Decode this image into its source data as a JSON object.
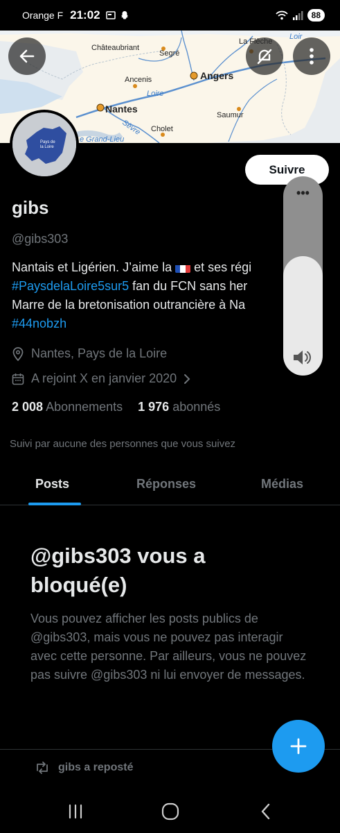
{
  "status_bar": {
    "carrier": "Orange F",
    "time": "21:02",
    "battery": "88"
  },
  "banner": {
    "map_labels": {
      "chateaubriant": "Châteaubriant",
      "segre": "Segré",
      "la_fleche": "La Flèche",
      "loir": "Loir",
      "ancenis": "Ancenis",
      "angers": "Angers",
      "loire": "Loire",
      "nantes": "Nantes",
      "sevre": "Sèvre",
      "saumur": "Saumur",
      "cholet": "Cholet",
      "grand_lieu": "e Grand-Lieu"
    }
  },
  "avatar": {
    "label_line1": "Pays de",
    "label_line2": "la Loire"
  },
  "profile": {
    "follow_label": "Suivre",
    "display_name": "gibs",
    "handle": "@gibs303",
    "bio": {
      "line1_before_flag": "Nantais et Ligérien. J’aime la ",
      "line1_after_flag": " et ses régi",
      "line2_tag": "#PaysdelaLoire5sur5",
      "line2_text": " fan du FCN sans her",
      "line3": "Marre de la bretonisation outrancière à Na",
      "line4_tag": "#44nobzh"
    },
    "location": "Nantes, Pays de la Loire",
    "joined": "A rejoint X en janvier 2020",
    "following_count": "2 008",
    "following_label": "Abonnements",
    "followers_count": "1 976",
    "followers_label": "abonnés",
    "followed_by": "Suivi par aucune des personnes que vous suivez"
  },
  "tabs": [
    {
      "label": "Posts",
      "active": true
    },
    {
      "label": "Réponses",
      "active": false
    },
    {
      "label": "Médias",
      "active": false
    }
  ],
  "blocked": {
    "title": "@gibs303 vous a bloqué(e)",
    "body": "Vous pouvez afficher les posts publics de @gibs303, mais vous ne pouvez pas interagir avec cette personne. Par ailleurs, vous ne pouvez pas suivre @gibs303 ni lui envoyer de messages."
  },
  "repost": {
    "label": "gibs a reposté"
  },
  "volume": {
    "level": 0.6
  },
  "colors": {
    "accent": "#1d9bf0",
    "background": "#000000",
    "text_primary": "#e7e9ea",
    "text_secondary": "#71767b"
  },
  "icons": {
    "back": "arrow-left-icon",
    "no_notifications": "bell-slash-icon",
    "more": "more-vertical-icon",
    "location": "location-pin-icon",
    "calendar": "calendar-icon",
    "chevron": "chevron-right-icon",
    "repost": "repost-icon",
    "compose": "plus-icon",
    "speaker": "speaker-icon"
  }
}
